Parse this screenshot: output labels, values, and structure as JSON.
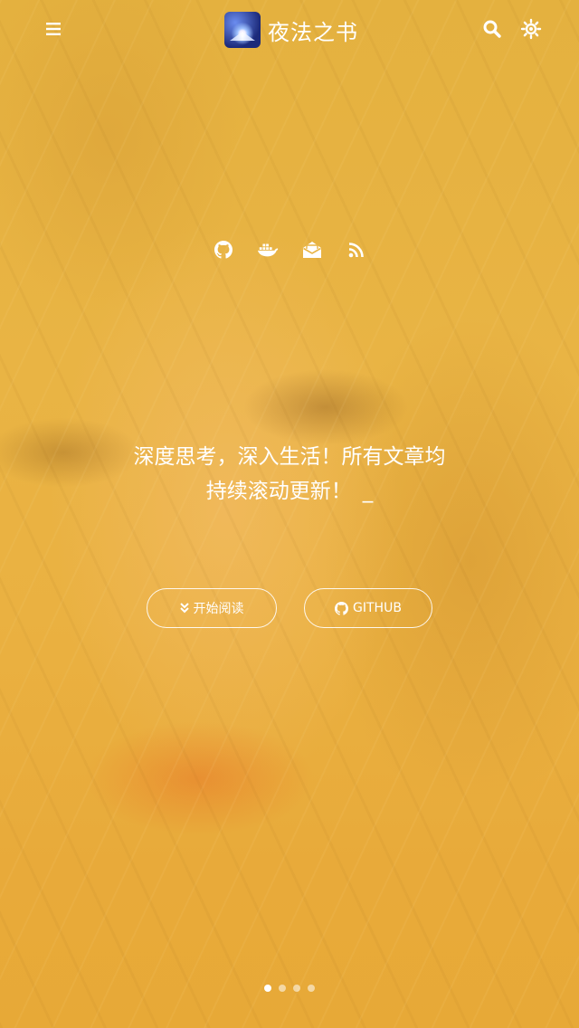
{
  "header": {
    "site_title": "夜法之书",
    "menu_icon": "menu-icon",
    "search_icon": "search-icon",
    "theme_icon": "theme-toggle-icon"
  },
  "social_links": [
    {
      "name": "github",
      "icon": "github-icon"
    },
    {
      "name": "docker",
      "icon": "docker-icon"
    },
    {
      "name": "email",
      "icon": "email-icon"
    },
    {
      "name": "rss",
      "icon": "rss-icon"
    }
  ],
  "hero": {
    "slogan_line1": "深度思考，深入生活！所有文章均",
    "slogan_line2": "持续滚动更新！",
    "cursor": "_"
  },
  "buttons": {
    "start_reading_label": "开始阅读",
    "github_label": "GITHUB"
  },
  "carousel": {
    "total": 4,
    "active_index": 0
  },
  "colors": {
    "overlay": "#e9b444",
    "text": "#ffffff"
  }
}
